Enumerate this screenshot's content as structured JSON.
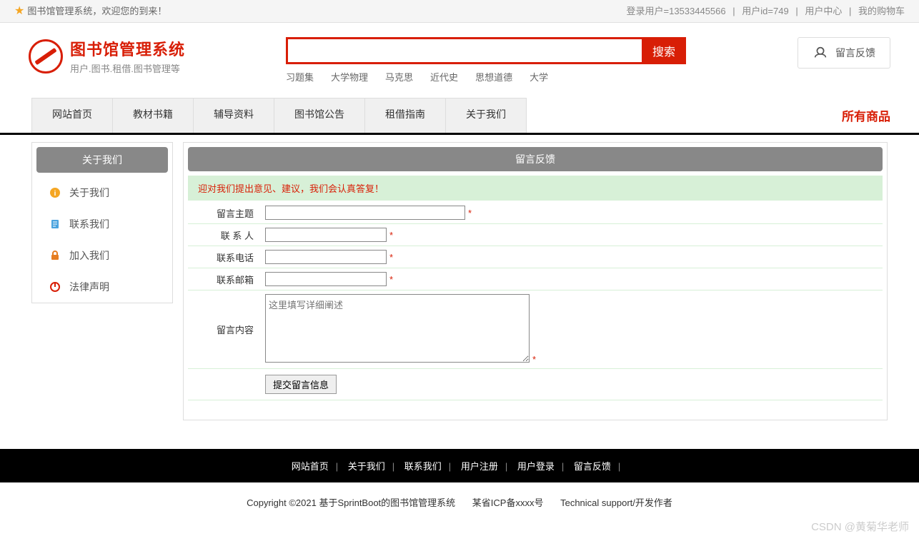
{
  "topbar": {
    "welcome": "图书馆管理系统，欢迎您的到来！",
    "login_user_label": "登录用户=",
    "login_user": "13533445566",
    "user_id_label": "用户id=",
    "user_id": "749",
    "user_center": "用户中心",
    "my_cart": "我的购物车"
  },
  "logo": {
    "title": "图书馆管理系统",
    "subtitle": "用户.图书.租借.图书管理等"
  },
  "search": {
    "value": "",
    "button": "搜索",
    "hotwords": [
      "习题集",
      "大学物理",
      "马克思",
      "近代史",
      "思想道德",
      "大学"
    ]
  },
  "feedback_btn": "留言反馈",
  "nav": {
    "items": [
      "网站首页",
      "教材书籍",
      "辅导资料",
      "图书馆公告",
      "租借指南",
      "关于我们"
    ],
    "right": "所有商品"
  },
  "sidebar": {
    "title": "关于我们",
    "items": [
      {
        "label": "关于我们",
        "icon": "info"
      },
      {
        "label": "联系我们",
        "icon": "doc"
      },
      {
        "label": "加入我们",
        "icon": "lock"
      },
      {
        "label": "法律声明",
        "icon": "power"
      }
    ]
  },
  "panel": {
    "title": "留言反馈",
    "notice": "迎对我们提出意见、建议，我们会认真答复！",
    "fields": {
      "subject": "留言主题",
      "contact": "联 系 人",
      "phone": "联系电话",
      "email": "联系邮箱",
      "content": "留言内容",
      "content_placeholder": "这里填写详细阐述"
    },
    "required": "*",
    "submit": "提交留言信息"
  },
  "footer": {
    "links": [
      "网站首页",
      "关于我们",
      "联系我们",
      "用户注册",
      "用户登录",
      "留言反馈"
    ],
    "copyright": "Copyright ©2021 基于SprintBoot的图书馆管理系统",
    "icp": "某省ICP备xxxx号",
    "support": "Technical support/开发作者"
  },
  "watermark": "CSDN @黄菊华老师"
}
